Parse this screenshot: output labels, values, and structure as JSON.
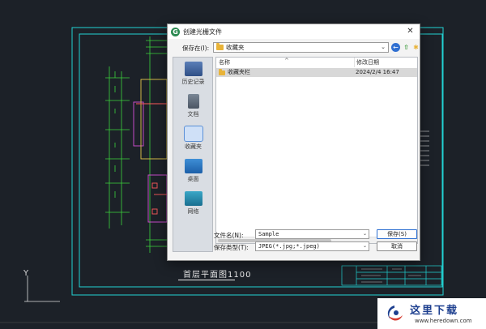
{
  "cad": {
    "drawing_caption": "首层平面图1100",
    "axis_label_y": "Y"
  },
  "dialog": {
    "title": "创建光栅文件",
    "close_glyph": "✕",
    "look_in_label": "保存在(I):",
    "look_in_value": "收藏夹",
    "places": [
      {
        "label": "历史记录",
        "icon": "history-icon"
      },
      {
        "label": "文档",
        "icon": "documents-icon"
      },
      {
        "label": "收藏夹",
        "icon": "favorites-icon",
        "selected": true
      },
      {
        "label": "桌面",
        "icon": "desktop-icon"
      },
      {
        "label": "网络",
        "icon": "network-icon"
      }
    ],
    "columns": {
      "name": "名称",
      "modified": "修改日期"
    },
    "files": [
      {
        "name": "收藏夹栏",
        "modified": "2024/2/4 16:47"
      }
    ],
    "filename_label": "文件名(N):",
    "filename_value": "Sample",
    "filetype_label": "保存类型(T):",
    "filetype_value": "JPEG(*.jpg;*.jpeg)",
    "save_label": "保存(S)",
    "cancel_label": "取消"
  },
  "watermark": {
    "title": "这里下载",
    "url": "www.heredown.com"
  },
  "colors": {
    "cad_background": "#1c2128",
    "cad_cyan": "#22d3d3",
    "cad_green": "#3bd43b",
    "accent_blue": "#2d6fd1",
    "folder_yellow": "#e8b339"
  }
}
